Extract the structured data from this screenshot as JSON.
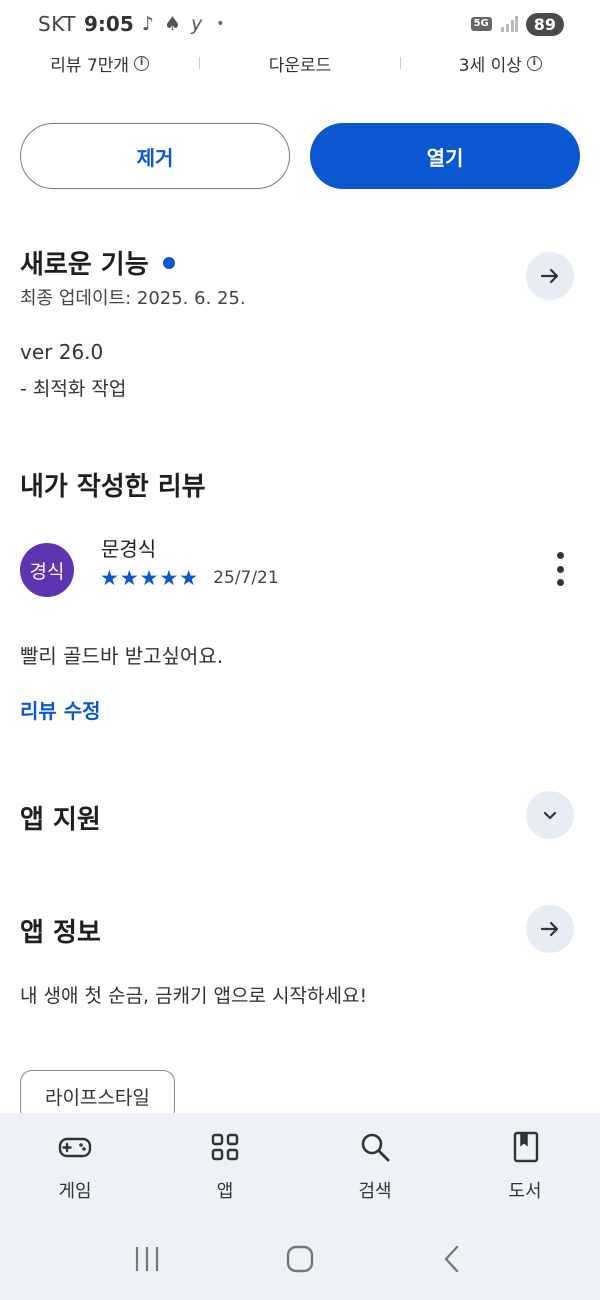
{
  "status_bar": {
    "carrier": "SKT",
    "time": "9:05",
    "notifications": "♪ ♠ y",
    "dot": "•",
    "network": "5G",
    "battery": "89"
  },
  "stats": {
    "reviews": "리뷰 7만개",
    "downloads": "다운로드",
    "age": "3세 이상"
  },
  "actions": {
    "remove_label": "제거",
    "open_label": "열기"
  },
  "whats_new": {
    "title": "새로운 기능",
    "last_update": "최종 업데이트: 2025. 6. 25.",
    "version": "ver 26.0",
    "note": "- 최적화 작업"
  },
  "my_review": {
    "title": "내가 작성한 리뷰",
    "avatar_text": "경식",
    "reviewer_name": "문경식",
    "stars": "★★★★★",
    "rating": 5,
    "date": "25/7/21",
    "text": "빨리 골드바 받고싶어요.",
    "edit_label": "리뷰 수정"
  },
  "app_support": {
    "title": "앱 지원"
  },
  "app_info": {
    "title": "앱 정보",
    "description": "내 생애 첫 순금, 금캐기 앱으로 시작하세요!",
    "category_chip": "라이프스타일"
  },
  "bottom_nav": {
    "items": [
      {
        "label": "게임",
        "icon": "gamepad-icon"
      },
      {
        "label": "앱",
        "icon": "apps-grid-icon"
      },
      {
        "label": "검색",
        "icon": "search-icon"
      },
      {
        "label": "도서",
        "icon": "book-icon"
      }
    ]
  },
  "colors": {
    "accent": "#0b57d0",
    "avatar_bg": "#5e35b1",
    "nav_bg": "#eef2f8"
  }
}
